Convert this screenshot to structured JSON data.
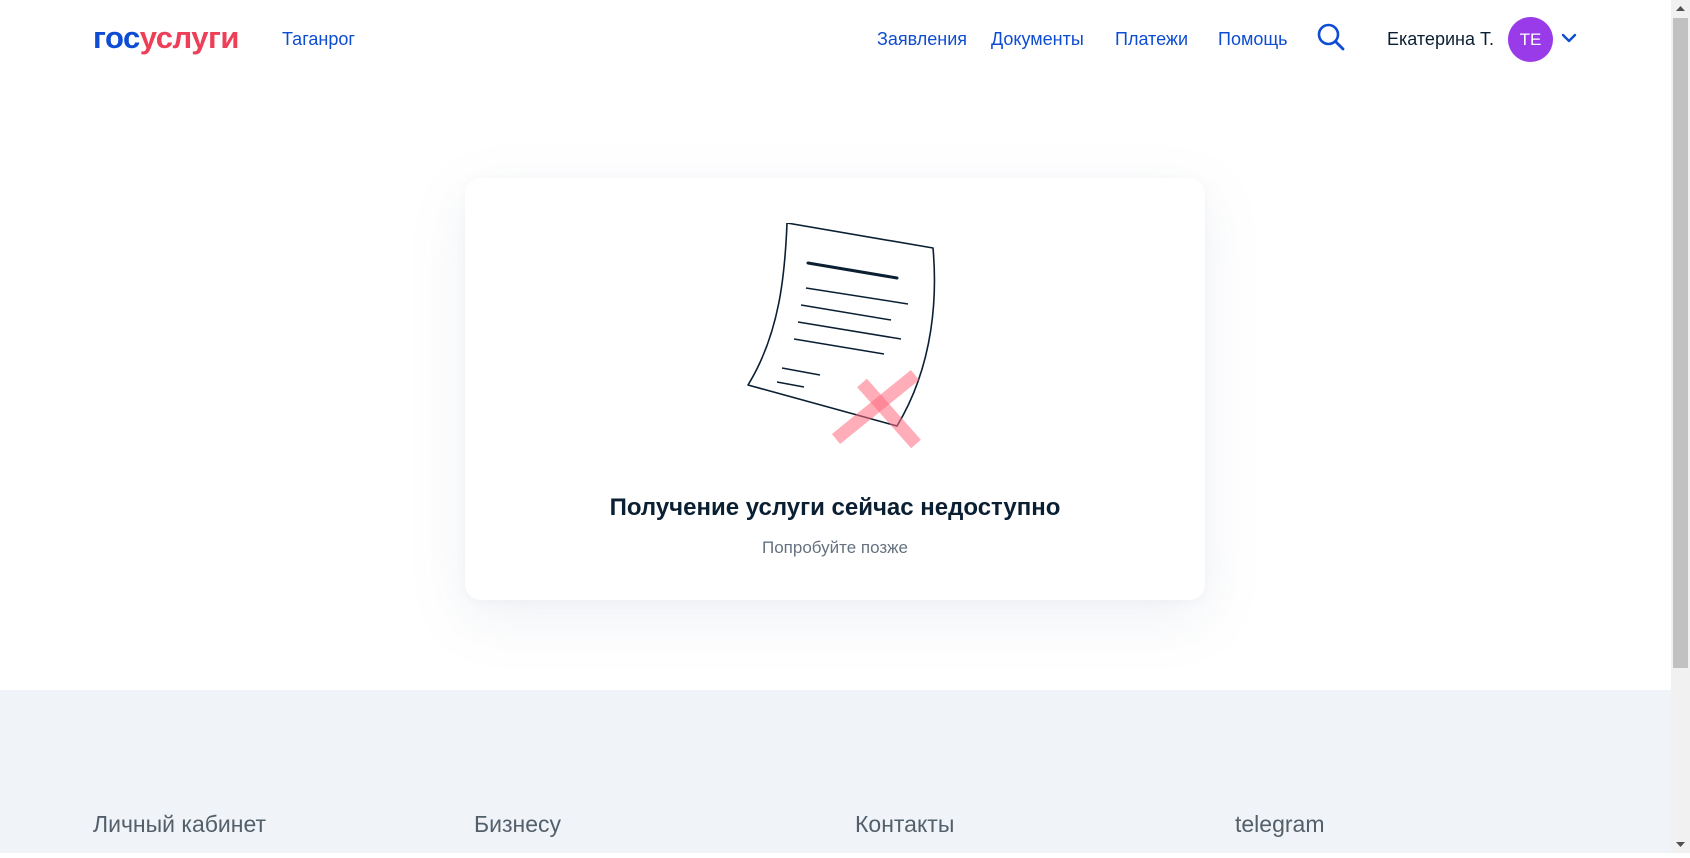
{
  "header": {
    "logo_part1": "гос",
    "logo_part2": "услуги",
    "city": "Таганрог",
    "nav": [
      "Заявления",
      "Документы",
      "Платежи",
      "Помощь"
    ],
    "user_name": "Екатерина Т.",
    "avatar_initials": "ТЕ"
  },
  "main": {
    "title": "Получение услуги сейчас недоступно",
    "subtitle": "Попробуйте позже"
  },
  "footer": {
    "columns": [
      "Личный кабинет",
      "Бизнесу",
      "Контакты",
      "telegram"
    ]
  },
  "colors": {
    "brand_blue": "#0d4cd3",
    "brand_red": "#ee3f58",
    "avatar_purple": "#9a3be9",
    "footer_bg": "#f0f4f8"
  },
  "icons": {
    "search": "search-icon",
    "dropdown": "chevron-down-icon",
    "illustration": "rejected-document-icon"
  }
}
